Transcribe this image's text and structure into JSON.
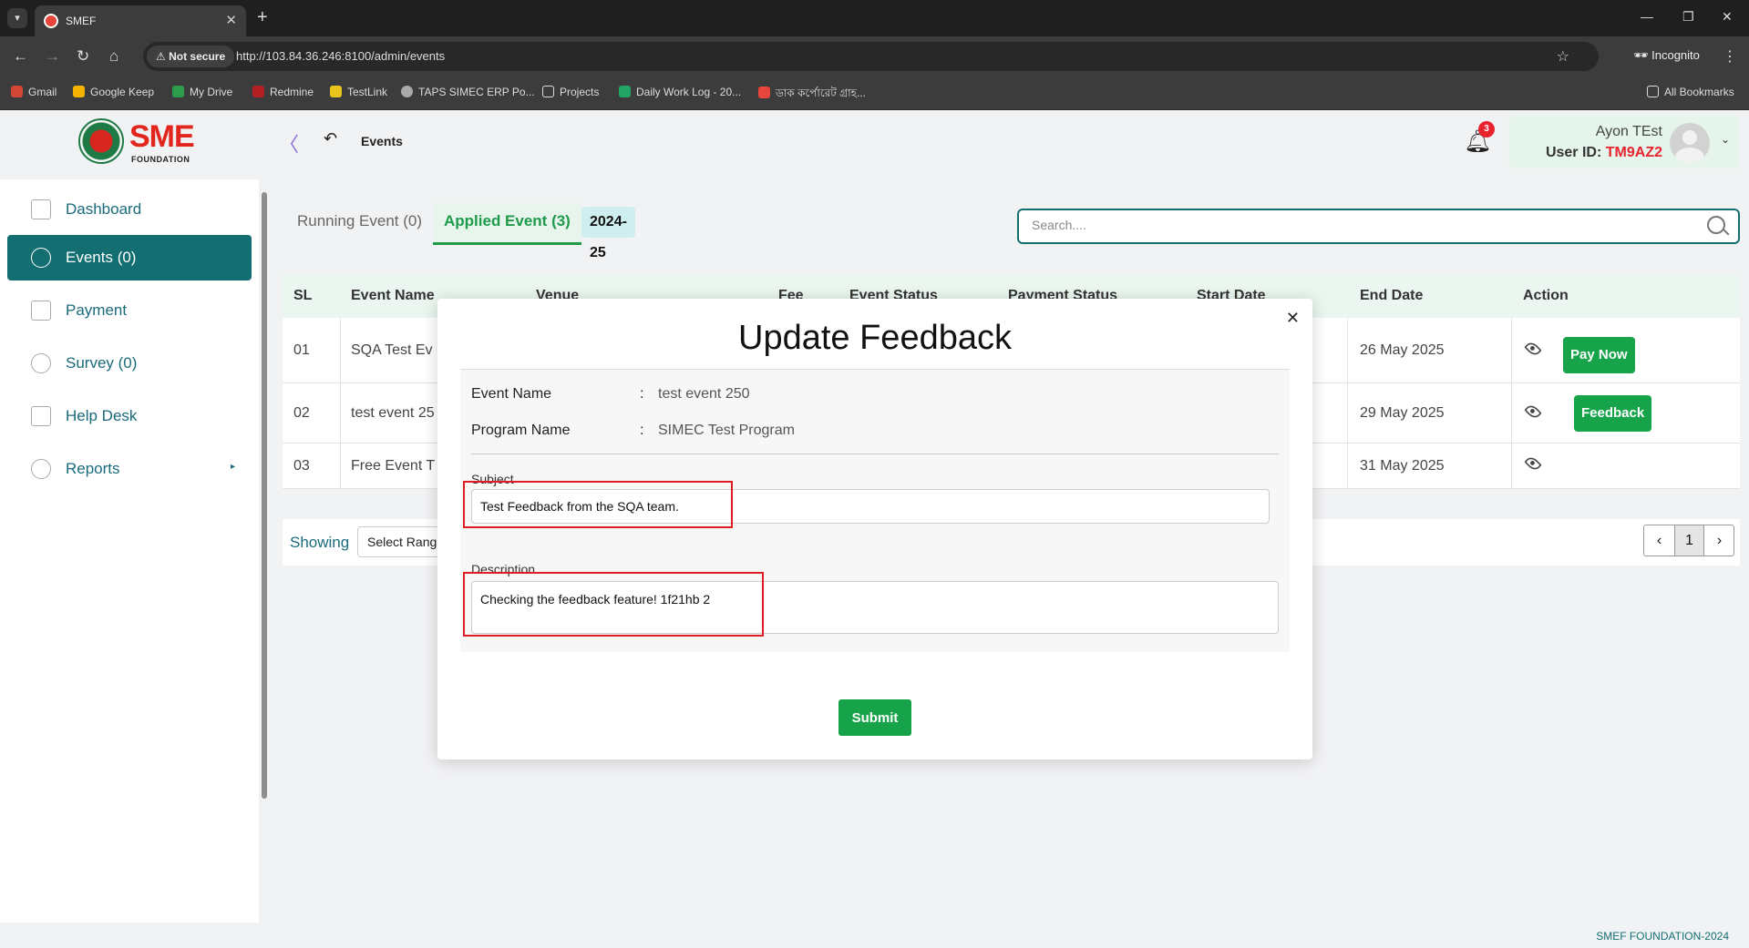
{
  "browser": {
    "tab_title": "SMEF",
    "not_secure": "Not secure",
    "url": "http://103.84.36.246:8100/admin/events",
    "incognito": "Incognito",
    "bookmarks": [
      "Gmail",
      "Google Keep",
      "My Drive",
      "Redmine",
      "TestLink",
      "TAPS SIMEC ERP Po...",
      "Projects",
      "Daily Work Log - 20...",
      "ডাক কর্পোরেট গ্রাহ..."
    ],
    "all_bookmarks": "All Bookmarks"
  },
  "header": {
    "logo_text": "SME",
    "logo_sub": "FOUNDATION",
    "page_title": "Events",
    "notification_count": "3",
    "user_name": "Ayon TEst",
    "user_id_label": "User ID:",
    "user_id": "TM9AZ2"
  },
  "sidebar": {
    "items": [
      {
        "label": "Dashboard",
        "active": false
      },
      {
        "label": "Events (0)",
        "active": true
      },
      {
        "label": "Payment",
        "active": false
      },
      {
        "label": "Survey (0)",
        "active": false
      },
      {
        "label": "Help Desk",
        "active": false
      },
      {
        "label": "Reports",
        "active": false
      }
    ]
  },
  "tabs": {
    "running": "Running Event (0)",
    "applied": "Applied Event (3)",
    "year": "2024-25"
  },
  "search": {
    "placeholder": "Search...."
  },
  "table": {
    "headers": [
      "SL",
      "Event Name",
      "Venue",
      "Fee",
      "Event Status",
      "Payment Status",
      "Start Date",
      "End Date",
      "Action"
    ],
    "rows": [
      {
        "sl": "01",
        "name": "SQA Test Ev",
        "end_date": "26 May 2025",
        "button": "Pay Now"
      },
      {
        "sl": "02",
        "name": "test event 25",
        "end_date": "29 May 2025",
        "button": "Feedback"
      },
      {
        "sl": "03",
        "name": "Free Event T",
        "end_date": "31 May 2025",
        "button": ""
      }
    ]
  },
  "pagination": {
    "showing_label": "Showing",
    "range_select": "Select Rang",
    "current_page": "1"
  },
  "footer": {
    "text": "SMEF FOUNDATION-2024"
  },
  "modal": {
    "title": "Update Feedback",
    "event_name_label": "Event Name",
    "event_name_value": "test event 250",
    "program_name_label": "Program Name",
    "program_name_value": "SIMEC Test Program",
    "colon": ":",
    "subject_label": "Subject",
    "subject_value": "Test Feedback from the SQA team.",
    "description_label": "Description",
    "description_value": "Checking the feedback feature! 1f21hb 2",
    "submit_label": "Submit"
  },
  "colors": {
    "brand_teal": "#136e72",
    "brand_green": "#17a34a",
    "highlight_red": "#e01c24",
    "badge_red": "#e8232e"
  }
}
